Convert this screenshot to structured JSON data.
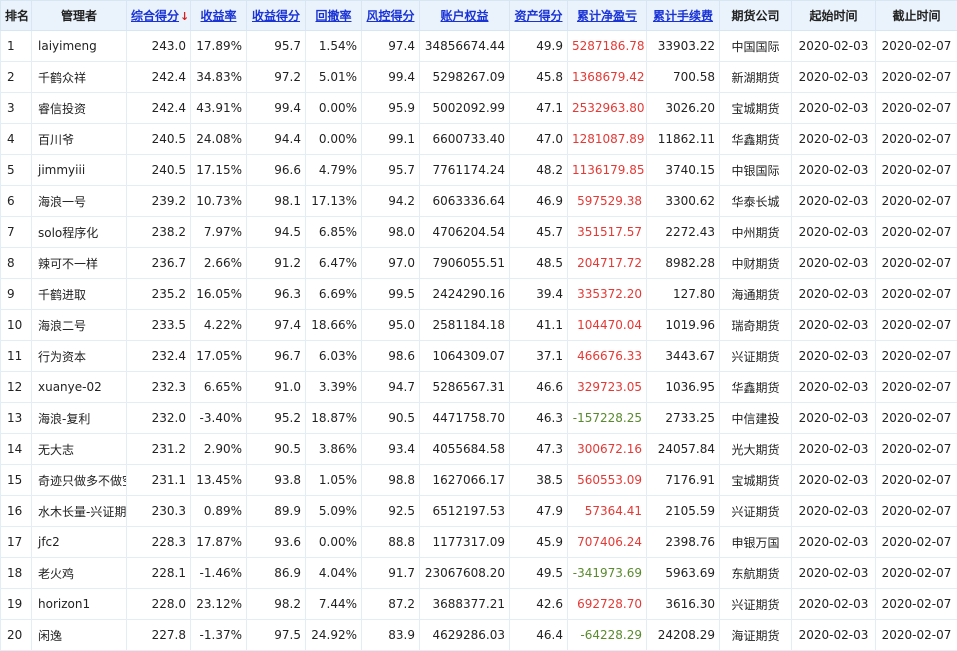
{
  "colors": {
    "positive": "#e53935",
    "negative": "#5a8a2e",
    "header_link": "#1a33d6",
    "header_bg": "#eaf3fb"
  },
  "headers": {
    "rank": "排名",
    "manager": "管理者",
    "score": "综合得分",
    "sort_arrow": "↓",
    "return_rate": "收益率",
    "return_score": "收益得分",
    "drawdown": "回撤率",
    "risk_score": "风控得分",
    "equity": "账户权益",
    "asset_score": "资产得分",
    "net_pl": "累计净盈亏",
    "fee": "累计手续费",
    "broker": "期货公司",
    "start": "起始时间",
    "end": "截止时间"
  },
  "rows": [
    {
      "rank": "1",
      "manager": "laiyimeng",
      "score": "243.0",
      "return_rate": "17.89%",
      "return_score": "95.7",
      "drawdown": "1.54%",
      "risk_score": "97.4",
      "equity": "34856674.44",
      "asset_score": "49.9",
      "net_pl": "5287186.78",
      "fee": "33903.22",
      "broker": "中国国际",
      "start": "2020-02-03",
      "end": "2020-02-07"
    },
    {
      "rank": "2",
      "manager": "千鹤众祥",
      "score": "242.4",
      "return_rate": "34.83%",
      "return_score": "97.2",
      "drawdown": "5.01%",
      "risk_score": "99.4",
      "equity": "5298267.09",
      "asset_score": "45.8",
      "net_pl": "1368679.42",
      "fee": "700.58",
      "broker": "新湖期货",
      "start": "2020-02-03",
      "end": "2020-02-07"
    },
    {
      "rank": "3",
      "manager": "睿信投资",
      "score": "242.4",
      "return_rate": "43.91%",
      "return_score": "99.4",
      "drawdown": "0.00%",
      "risk_score": "95.9",
      "equity": "5002092.99",
      "asset_score": "47.1",
      "net_pl": "2532963.80",
      "fee": "3026.20",
      "broker": "宝城期货",
      "start": "2020-02-03",
      "end": "2020-02-07"
    },
    {
      "rank": "4",
      "manager": "百川爷",
      "score": "240.5",
      "return_rate": "24.08%",
      "return_score": "94.4",
      "drawdown": "0.00%",
      "risk_score": "99.1",
      "equity": "6600733.40",
      "asset_score": "47.0",
      "net_pl": "1281087.89",
      "fee": "11862.11",
      "broker": "华鑫期货",
      "start": "2020-02-03",
      "end": "2020-02-07"
    },
    {
      "rank": "5",
      "manager": "jimmyiii",
      "score": "240.5",
      "return_rate": "17.15%",
      "return_score": "96.6",
      "drawdown": "4.79%",
      "risk_score": "95.7",
      "equity": "7761174.24",
      "asset_score": "48.2",
      "net_pl": "1136179.85",
      "fee": "3740.15",
      "broker": "中银国际",
      "start": "2020-02-03",
      "end": "2020-02-07"
    },
    {
      "rank": "6",
      "manager": "海浪一号",
      "score": "239.2",
      "return_rate": "10.73%",
      "return_score": "98.1",
      "drawdown": "17.13%",
      "risk_score": "94.2",
      "equity": "6063336.64",
      "asset_score": "46.9",
      "net_pl": "597529.38",
      "fee": "3300.62",
      "broker": "华泰长城",
      "start": "2020-02-03",
      "end": "2020-02-07"
    },
    {
      "rank": "7",
      "manager": "solo程序化",
      "score": "238.2",
      "return_rate": "7.97%",
      "return_score": "94.5",
      "drawdown": "6.85%",
      "risk_score": "98.0",
      "equity": "4706204.54",
      "asset_score": "45.7",
      "net_pl": "351517.57",
      "fee": "2272.43",
      "broker": "中州期货",
      "start": "2020-02-03",
      "end": "2020-02-07"
    },
    {
      "rank": "8",
      "manager": "辣可不一样",
      "score": "236.7",
      "return_rate": "2.66%",
      "return_score": "91.2",
      "drawdown": "6.47%",
      "risk_score": "97.0",
      "equity": "7906055.51",
      "asset_score": "48.5",
      "net_pl": "204717.72",
      "fee": "8982.28",
      "broker": "中财期货",
      "start": "2020-02-03",
      "end": "2020-02-07"
    },
    {
      "rank": "9",
      "manager": "千鹤进取",
      "score": "235.2",
      "return_rate": "16.05%",
      "return_score": "96.3",
      "drawdown": "6.69%",
      "risk_score": "99.5",
      "equity": "2424290.16",
      "asset_score": "39.4",
      "net_pl": "335372.20",
      "fee": "127.80",
      "broker": "海通期货",
      "start": "2020-02-03",
      "end": "2020-02-07"
    },
    {
      "rank": "10",
      "manager": "海浪二号",
      "score": "233.5",
      "return_rate": "4.22%",
      "return_score": "97.4",
      "drawdown": "18.66%",
      "risk_score": "95.0",
      "equity": "2581184.18",
      "asset_score": "41.1",
      "net_pl": "104470.04",
      "fee": "1019.96",
      "broker": "瑞奇期货",
      "start": "2020-02-03",
      "end": "2020-02-07"
    },
    {
      "rank": "11",
      "manager": "行为资本",
      "score": "232.4",
      "return_rate": "17.05%",
      "return_score": "96.7",
      "drawdown": "6.03%",
      "risk_score": "98.6",
      "equity": "1064309.07",
      "asset_score": "37.1",
      "net_pl": "466676.33",
      "fee": "3443.67",
      "broker": "兴证期货",
      "start": "2020-02-03",
      "end": "2020-02-07"
    },
    {
      "rank": "12",
      "manager": "xuanye-02",
      "score": "232.3",
      "return_rate": "6.65%",
      "return_score": "91.0",
      "drawdown": "3.39%",
      "risk_score": "94.7",
      "equity": "5286567.31",
      "asset_score": "46.6",
      "net_pl": "329723.05",
      "fee": "1036.95",
      "broker": "华鑫期货",
      "start": "2020-02-03",
      "end": "2020-02-07"
    },
    {
      "rank": "13",
      "manager": "海浪-复利",
      "score": "232.0",
      "return_rate": "-3.40%",
      "return_score": "95.2",
      "drawdown": "18.87%",
      "risk_score": "90.5",
      "equity": "4471758.70",
      "asset_score": "46.3",
      "net_pl": "-157228.25",
      "fee": "2733.25",
      "broker": "中信建投",
      "start": "2020-02-03",
      "end": "2020-02-07"
    },
    {
      "rank": "14",
      "manager": "无大志",
      "score": "231.2",
      "return_rate": "2.90%",
      "return_score": "90.5",
      "drawdown": "3.86%",
      "risk_score": "93.4",
      "equity": "4055684.58",
      "asset_score": "47.3",
      "net_pl": "300672.16",
      "fee": "24057.84",
      "broker": "光大期货",
      "start": "2020-02-03",
      "end": "2020-02-07"
    },
    {
      "rank": "15",
      "manager": "奇迹只做多不做空",
      "score": "231.1",
      "return_rate": "13.45%",
      "return_score": "93.8",
      "drawdown": "1.05%",
      "risk_score": "98.8",
      "equity": "1627066.17",
      "asset_score": "38.5",
      "net_pl": "560553.09",
      "fee": "7176.91",
      "broker": "宝城期货",
      "start": "2020-02-03",
      "end": "2020-02-07"
    },
    {
      "rank": "16",
      "manager": "水木长量-兴证期货",
      "score": "230.3",
      "return_rate": "0.89%",
      "return_score": "89.9",
      "drawdown": "5.09%",
      "risk_score": "92.5",
      "equity": "6512197.53",
      "asset_score": "47.9",
      "net_pl": "57364.41",
      "fee": "2105.59",
      "broker": "兴证期货",
      "start": "2020-02-03",
      "end": "2020-02-07"
    },
    {
      "rank": "17",
      "manager": "jfc2",
      "score": "228.3",
      "return_rate": "17.87%",
      "return_score": "93.6",
      "drawdown": "0.00%",
      "risk_score": "88.8",
      "equity": "1177317.09",
      "asset_score": "45.9",
      "net_pl": "707406.24",
      "fee": "2398.76",
      "broker": "申银万国",
      "start": "2020-02-03",
      "end": "2020-02-07"
    },
    {
      "rank": "18",
      "manager": "老火鸡",
      "score": "228.1",
      "return_rate": "-1.46%",
      "return_score": "86.9",
      "drawdown": "4.04%",
      "risk_score": "91.7",
      "equity": "23067608.20",
      "asset_score": "49.5",
      "net_pl": "-341973.69",
      "fee": "5963.69",
      "broker": "东航期货",
      "start": "2020-02-03",
      "end": "2020-02-07"
    },
    {
      "rank": "19",
      "manager": "horizon1",
      "score": "228.0",
      "return_rate": "23.12%",
      "return_score": "98.2",
      "drawdown": "7.44%",
      "risk_score": "87.2",
      "equity": "3688377.21",
      "asset_score": "42.6",
      "net_pl": "692728.70",
      "fee": "3616.30",
      "broker": "兴证期货",
      "start": "2020-02-03",
      "end": "2020-02-07"
    },
    {
      "rank": "20",
      "manager": "闲逸",
      "score": "227.8",
      "return_rate": "-1.37%",
      "return_score": "97.5",
      "drawdown": "24.92%",
      "risk_score": "83.9",
      "equity": "4629286.03",
      "asset_score": "46.4",
      "net_pl": "-64228.29",
      "fee": "24208.29",
      "broker": "海证期货",
      "start": "2020-02-03",
      "end": "2020-02-07"
    }
  ]
}
